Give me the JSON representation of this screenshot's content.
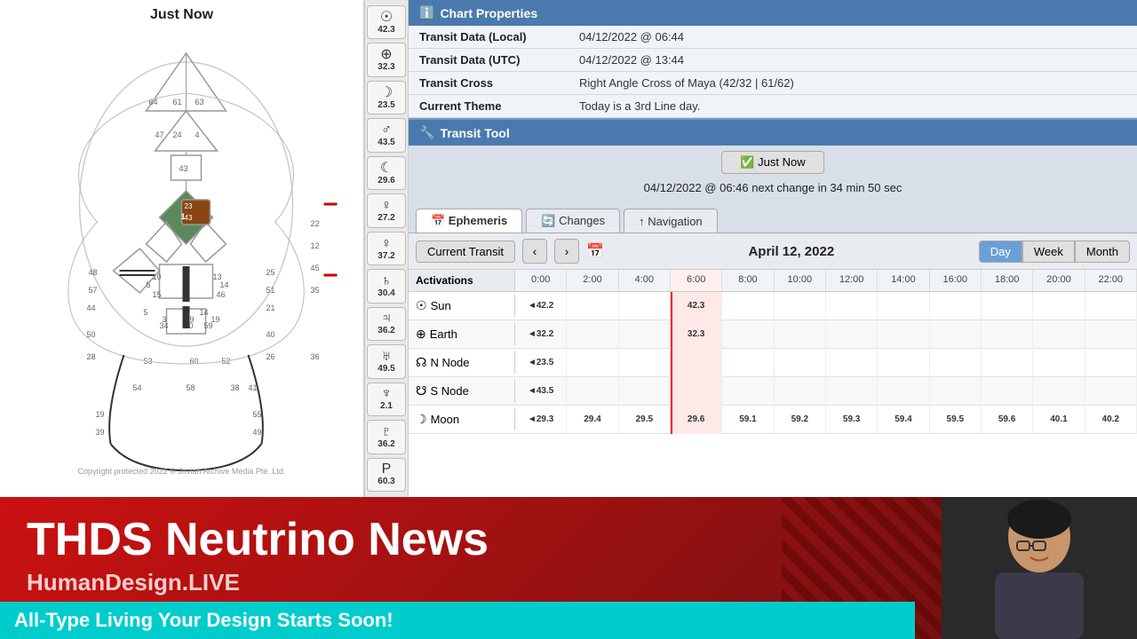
{
  "chart": {
    "title": "Just Now",
    "copyright": "Copyright protected 2022 © Jovian Archive Media Pte. Ltd."
  },
  "sidebar": {
    "items": [
      {
        "icon": "☉",
        "num": "42.3"
      },
      {
        "icon": "⊕",
        "num": "32.3"
      },
      {
        "icon": "☽",
        "num": "23.5"
      },
      {
        "icon": "♂",
        "num": "43.5"
      },
      {
        "icon": "☾",
        "num": "29.6"
      },
      {
        "icon": "♀",
        "num": "27.2"
      },
      {
        "icon": "♀",
        "num": "37.2"
      },
      {
        "icon": "♄",
        "num": "30.4"
      },
      {
        "icon": "♃",
        "num": "36.2"
      },
      {
        "icon": "♅",
        "num": "49.5"
      },
      {
        "icon": "♆",
        "num": "2.1"
      },
      {
        "icon": "♇",
        "num": "36.2"
      },
      {
        "icon": "P",
        "num": "60.3"
      }
    ]
  },
  "chartProperties": {
    "sectionTitle": "Chart Properties",
    "rows": [
      {
        "label": "Transit Data (Local)",
        "value": "04/12/2022 @ 06:44"
      },
      {
        "label": "Transit Data (UTC)",
        "value": "04/12/2022 @ 13:44"
      },
      {
        "label": "Transit Cross",
        "value": "Right Angle Cross of Maya (42/32 | 61/62)"
      },
      {
        "label": "Current Theme",
        "value": "Today is a 3rd Line day."
      }
    ]
  },
  "transitTool": {
    "sectionTitle": "Transit Tool",
    "justNowLabel": "✅ Just Now",
    "timeInfo": "04/12/2022 @ 06:46 next change in 34 min 50 sec",
    "tabs": [
      {
        "label": "Ephemeris",
        "icon": "📅",
        "active": true
      },
      {
        "label": "Changes",
        "icon": "🔄",
        "active": false
      },
      {
        "label": "Navigation",
        "icon": "↑",
        "active": false
      }
    ],
    "currentTransitLabel": "Current Transit",
    "dateLabel": "April 12, 2022",
    "viewButtons": [
      "Day",
      "Week",
      "Month"
    ],
    "activeView": "Day",
    "timeColumns": [
      "0:00",
      "2:00",
      "4:00",
      "6:00",
      "8:00",
      "10:00",
      "12:00",
      "14:00",
      "16:00",
      "18:00",
      "20:00",
      "22:00"
    ],
    "activationsHeader": "Activations",
    "rows": [
      {
        "label": "Sun",
        "icon": "☉",
        "cells": [
          {
            "time": "0:00",
            "val": "◄42.2"
          },
          {
            "time": "2:00",
            "val": ""
          },
          {
            "time": "4:00",
            "val": ""
          },
          {
            "time": "6:00",
            "val": "42.3",
            "current": true
          },
          {
            "time": "8:00",
            "val": ""
          },
          {
            "time": "10:00",
            "val": ""
          },
          {
            "time": "12:00",
            "val": ""
          },
          {
            "time": "14:00",
            "val": ""
          },
          {
            "time": "16:00",
            "val": ""
          },
          {
            "time": "18:00",
            "val": ""
          },
          {
            "time": "20:00",
            "val": ""
          },
          {
            "time": "22:00",
            "val": ""
          }
        ]
      },
      {
        "label": "Earth",
        "icon": "⊕",
        "cells": [
          {
            "time": "0:00",
            "val": "◄32.2"
          },
          {
            "time": "2:00",
            "val": ""
          },
          {
            "time": "4:00",
            "val": ""
          },
          {
            "time": "6:00",
            "val": "32.3",
            "current": true
          },
          {
            "time": "8:00",
            "val": ""
          },
          {
            "time": "10:00",
            "val": ""
          },
          {
            "time": "12:00",
            "val": ""
          },
          {
            "time": "14:00",
            "val": ""
          },
          {
            "time": "16:00",
            "val": ""
          },
          {
            "time": "18:00",
            "val": ""
          },
          {
            "time": "20:00",
            "val": ""
          },
          {
            "time": "22:00",
            "val": ""
          }
        ]
      },
      {
        "label": "N Node",
        "icon": "☊",
        "cells": [
          {
            "time": "0:00",
            "val": "◄23.5"
          },
          {
            "time": "2:00",
            "val": ""
          },
          {
            "time": "4:00",
            "val": ""
          },
          {
            "time": "6:00",
            "val": "",
            "current": true
          },
          {
            "time": "8:00",
            "val": ""
          },
          {
            "time": "10:00",
            "val": ""
          },
          {
            "time": "12:00",
            "val": ""
          },
          {
            "time": "14:00",
            "val": ""
          },
          {
            "time": "16:00",
            "val": ""
          },
          {
            "time": "18:00",
            "val": ""
          },
          {
            "time": "20:00",
            "val": ""
          },
          {
            "time": "22:00",
            "val": ""
          }
        ]
      },
      {
        "label": "S Node",
        "icon": "☋",
        "cells": [
          {
            "time": "0:00",
            "val": "◄43.5"
          },
          {
            "time": "2:00",
            "val": ""
          },
          {
            "time": "4:00",
            "val": ""
          },
          {
            "time": "6:00",
            "val": "",
            "current": true
          },
          {
            "time": "8:00",
            "val": ""
          },
          {
            "time": "10:00",
            "val": ""
          },
          {
            "time": "12:00",
            "val": ""
          },
          {
            "time": "14:00",
            "val": ""
          },
          {
            "time": "16:00",
            "val": ""
          },
          {
            "time": "18:00",
            "val": ""
          },
          {
            "time": "20:00",
            "val": ""
          },
          {
            "time": "22:00",
            "val": ""
          }
        ]
      },
      {
        "label": "Moon",
        "icon": "☽",
        "cells": [
          {
            "time": "0:00",
            "val": "◄29.3"
          },
          {
            "time": "2:00",
            "val": "29.4"
          },
          {
            "time": "4:00",
            "val": "29.5"
          },
          {
            "time": "6:00",
            "val": "29.6",
            "current": true
          },
          {
            "time": "8:00",
            "val": "59.1"
          },
          {
            "time": "10:00",
            "val": "59.2"
          },
          {
            "time": "12:00",
            "val": "59.3"
          },
          {
            "time": "14:00",
            "val": "59.4"
          },
          {
            "time": "16:00",
            "val": "59.5"
          },
          {
            "time": "18:00",
            "val": "59.6"
          },
          {
            "time": "20:00",
            "val": "40.1"
          },
          {
            "time": "22:00",
            "val": "40.2"
          }
        ]
      }
    ]
  },
  "banner": {
    "title": "THDS Neutrino News",
    "subtitle": "HumanDesign.LIVE",
    "tagline": "All-Type Living Your Design Starts Soon!"
  }
}
